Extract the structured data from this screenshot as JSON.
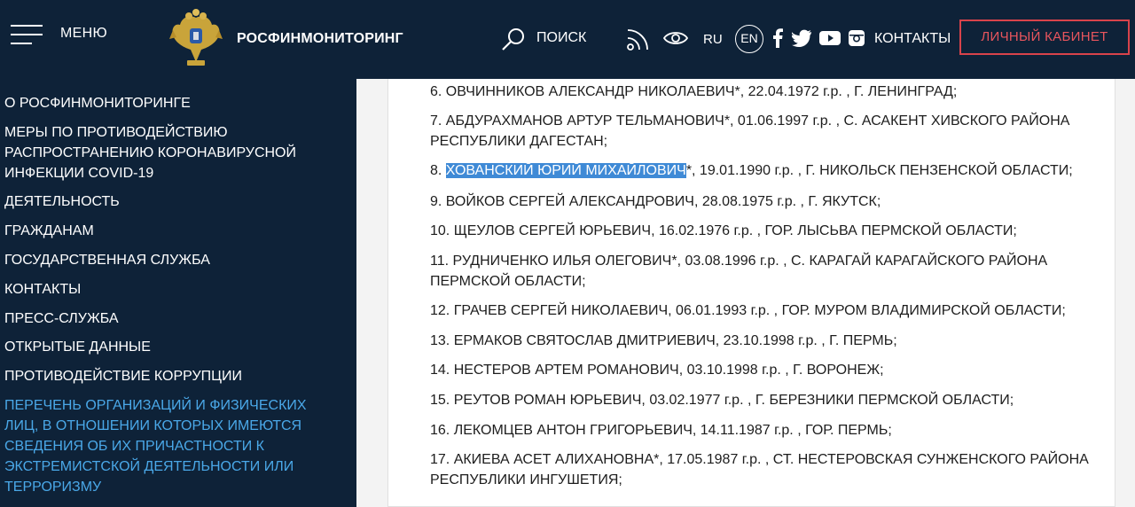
{
  "header": {
    "menu_label": "МЕНЮ",
    "brand": "РОСФИНМОНИТОРИНГ",
    "search_label": "ПОИСК",
    "lang_ru": "RU",
    "lang_en": "EN",
    "contacts": "КОНТАКТЫ",
    "cabinet": "ЛИЧНЫЙ КАБИНЕТ",
    "icons": [
      "hamburger-icon",
      "emblem-icon",
      "search-icon",
      "rss-icon",
      "eye-icon",
      "facebook-icon",
      "twitter-icon",
      "youtube-icon",
      "instagram-icon"
    ]
  },
  "colors": {
    "header_bg": "#0e2238",
    "accent_red": "#d8434b",
    "active_link": "#4aa8e8",
    "highlight": "#3f8ad6"
  },
  "sidebar": {
    "items": [
      {
        "lines": [
          "О РОСФИНМОНИТОРИНГЕ"
        ],
        "active": false
      },
      {
        "lines": [
          "МЕРЫ ПО ПРОТИВОДЕЙСТВИЮ",
          "РАСПРОСТРАНЕНИЮ КОРОНАВИРУСНОЙ",
          "ИНФЕКЦИИ COVID-19"
        ],
        "active": false
      },
      {
        "lines": [
          "ДЕЯТЕЛЬНОСТЬ"
        ],
        "active": false
      },
      {
        "lines": [
          "ГРАЖДАНАМ"
        ],
        "active": false
      },
      {
        "lines": [
          "ГОСУДАРСТВЕННАЯ СЛУЖБА"
        ],
        "active": false
      },
      {
        "lines": [
          "КОНТАКТЫ"
        ],
        "active": false
      },
      {
        "lines": [
          "ПРЕСС-СЛУЖБА"
        ],
        "active": false
      },
      {
        "lines": [
          "ОТКРЫТЫЕ ДАННЫЕ"
        ],
        "active": false
      },
      {
        "lines": [
          "ПРОТИВОДЕЙСТВИЕ КОРРУПЦИИ"
        ],
        "active": false
      },
      {
        "lines": [
          "ПЕРЕЧЕНЬ ОРГАНИЗАЦИЙ И ФИЗИЧЕСКИХ",
          "ЛИЦ, В ОТНОШЕНИИ КОТОРЫХ ИМЕЮТСЯ",
          "СВЕДЕНИЯ ОБ ИХ ПРИЧАСТНОСТИ К",
          "ЭКСТРЕМИСТСКОЙ ДЕЯТЕЛЬНОСТИ ИЛИ",
          "ТЕРРОРИЗМУ"
        ],
        "active": true
      }
    ]
  },
  "list": {
    "rows": [
      {
        "lines": [
          "6. ОВЧИННИКОВ АЛЕКСАНДР НИКОЛАЕВИЧ*, 22.04.1972 г.р. , Г. ЛЕНИНГРАД;"
        ]
      },
      {
        "lines": [
          "7. АБДУРАХМАНОВ АРТУР ТЕЛЬМАНОВИЧ*, 01.06.1997 г.р. , С. АСАКЕНТ ХИВСКОГО РАЙОНА",
          "РЕСПУБЛИКИ ДАГЕСТАН;"
        ]
      },
      {
        "prefix": "8. ",
        "selected": "ХОВАНСКИЙ ЮРИЙ МИХАЙЛОВИЧ",
        "suffix": "*, 19.01.1990 г.р. , Г. НИКОЛЬСК ПЕНЗЕНСКОЙ ОБЛАСТИ;"
      },
      {
        "lines": [
          "9. ВОЙКОВ СЕРГЕЙ АЛЕКСАНДРОВИЧ, 28.08.1975 г.р. , Г. ЯКУТСК;"
        ]
      },
      {
        "lines": [
          "10. ЩЕУЛОВ СЕРГЕЙ ЮРЬЕВИЧ, 16.02.1976 г.р. , ГОР. ЛЫСЬВА ПЕРМСКОЙ ОБЛАСТИ;"
        ]
      },
      {
        "lines": [
          "11. РУДНИЧЕНКО ИЛЬЯ ОЛЕГОВИЧ*, 03.08.1996 г.р. , С. КАРАГАЙ КАРАГАЙСКОГО РАЙОНА",
          "ПЕРМСКОЙ ОБЛАСТИ;"
        ]
      },
      {
        "lines": [
          "12. ГРАЧЕВ СЕРГЕЙ НИКОЛАЕВИЧ, 06.01.1993 г.р. , ГОР. МУРОМ ВЛАДИМИРСКОЙ ОБЛАСТИ;"
        ]
      },
      {
        "lines": [
          "13. ЕРМАКОВ СВЯТОСЛАВ ДМИТРИЕВИЧ, 23.10.1998 г.р. , Г. ПЕРМЬ;"
        ]
      },
      {
        "lines": [
          "14. НЕСТЕРОВ АРТЕМ РОМАНОВИЧ, 03.10.1998 г.р. , Г. ВОРОНЕЖ;"
        ]
      },
      {
        "lines": [
          "15. РЕУТОВ РОМАН ЮРЬЕВИЧ, 03.02.1977 г.р. , Г. БЕРЕЗНИКИ ПЕРМСКОЙ ОБЛАСТИ;"
        ]
      },
      {
        "lines": [
          "16. ЛЕКОМЦЕВ АНТОН ГРИГОРЬЕВИЧ, 14.11.1987 г.р. , ГОР. ПЕРМЬ;"
        ]
      },
      {
        "lines": [
          "17. АКИЕВА АСЕТ АЛИХАНОВНА*, 17.05.1987 г.р. , СТ. НЕСТЕРОВСКАЯ СУНЖЕНСКОГО РАЙОНА",
          "РЕСПУБЛИКИ ИНГУШЕТИЯ;"
        ]
      }
    ]
  }
}
